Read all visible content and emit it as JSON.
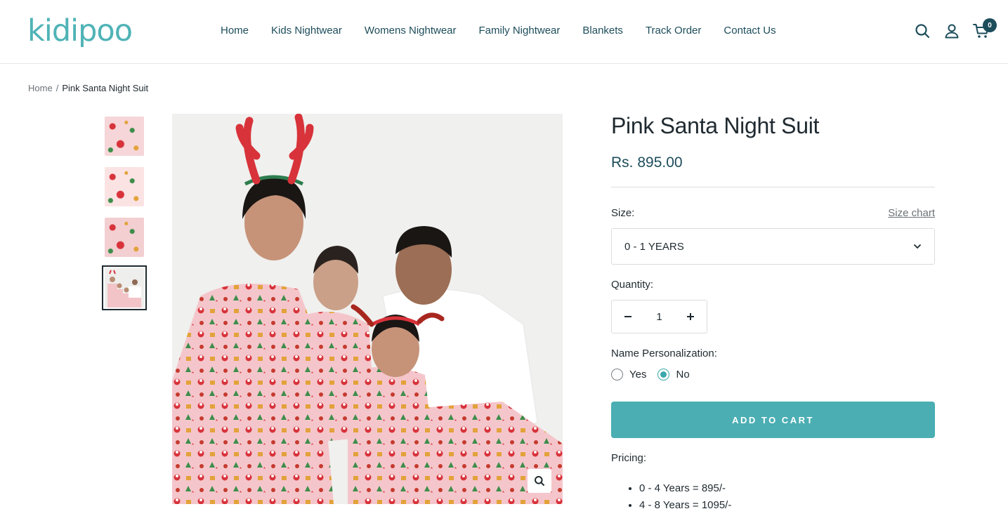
{
  "header": {
    "logo": "kidipoo",
    "nav": [
      {
        "label": "Home"
      },
      {
        "label": "Kids Nightwear"
      },
      {
        "label": "Womens Nightwear"
      },
      {
        "label": "Family Nightwear"
      },
      {
        "label": "Blankets"
      },
      {
        "label": "Track Order"
      },
      {
        "label": "Contact Us"
      }
    ],
    "icons": [
      "search-icon",
      "account-icon",
      "cart-icon"
    ],
    "cart_count": "0"
  },
  "breadcrumb": {
    "home": "Home",
    "separator": "/",
    "current": "Pink Santa Night Suit"
  },
  "gallery": {
    "thumbnail_count": 4,
    "active_index": 3
  },
  "product": {
    "title": "Pink Santa Night Suit",
    "price": "Rs. 895.00",
    "size_label": "Size:",
    "size_chart": "Size chart",
    "size_selected": "0 - 1 YEARS",
    "quantity_label": "Quantity:",
    "quantity": "1",
    "personalization_label": "Name Personalization:",
    "personalization_options": [
      "Yes",
      "No"
    ],
    "personalization_selected": "No",
    "add_to_cart": "ADD TO CART",
    "pricing_label": "Pricing:",
    "pricing": [
      "0 - 4 Years = 895/-",
      "4 - 8 Years = 1095/-"
    ]
  },
  "colors": {
    "brand": "#4fb3b6",
    "nav_text": "#1d4d5b",
    "button": "#4aaeb3",
    "radio_selected": "#3aa8ad"
  }
}
